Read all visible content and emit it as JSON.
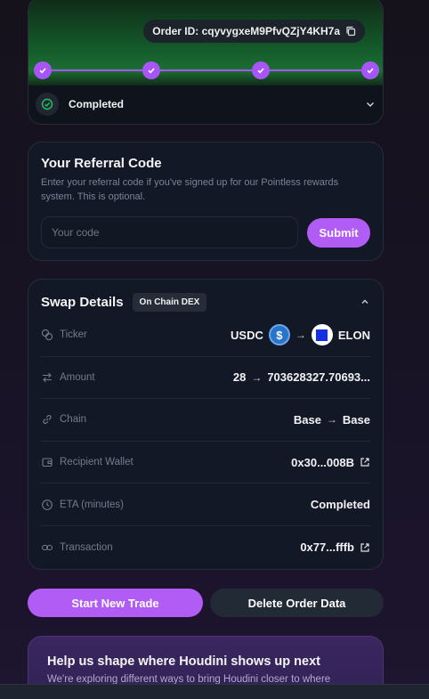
{
  "status": {
    "order_id": "Order ID: cqyvygxeM9PfvQZjY4KH7a",
    "steps": [
      "done",
      "done",
      "done",
      "done"
    ],
    "state_label": "Completed"
  },
  "referral": {
    "title": "Your Referral Code",
    "subtitle": "Enter your referral code if you've signed up for our Pointless rewards system. This is optional.",
    "placeholder": "Your code",
    "submit_label": "Submit"
  },
  "swap": {
    "title": "Swap Details",
    "badge": "On Chain DEX",
    "rows": {
      "ticker": {
        "label": "Ticker",
        "from": "USDC",
        "to": "ELON"
      },
      "amount": {
        "label": "Amount",
        "from": "28",
        "to": "703628327.70693..."
      },
      "chain": {
        "label": "Chain",
        "from": "Base",
        "to": "Base"
      },
      "wallet": {
        "label": "Recipient Wallet",
        "value": "0x30...008B"
      },
      "eta": {
        "label": "ETA (minutes)",
        "value": "Completed"
      },
      "tx": {
        "label": "Transaction",
        "value": "0x77...fffb"
      }
    }
  },
  "actions": {
    "start_label": "Start New Trade",
    "delete_label": "Delete Order Data"
  },
  "promo": {
    "title": "Help us shape where Houdini shows up next",
    "subtitle": "We're exploring different ways to bring Houdini closer to where"
  },
  "colors": {
    "accent": "#b25cf6",
    "success": "#22c55e",
    "card": "#121826"
  }
}
